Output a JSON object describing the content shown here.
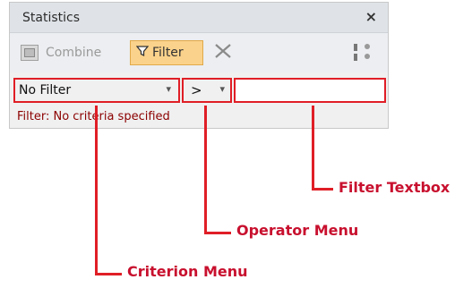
{
  "panel": {
    "title": "Statistics",
    "close_glyph": "×",
    "toolbar": {
      "combine_label": "Combine",
      "filter_label": "Filter",
      "filter_icon_glyph": "⏷",
      "clear_filter_glyph": "✕"
    },
    "filter_row": {
      "criterion_value": "No Filter",
      "operator_value": ">",
      "dropdown_arrow": "▾",
      "textbox_value": ""
    },
    "status_text": "Filter: No criteria specified"
  },
  "callouts": {
    "filter_textbox": "Filter Textbox",
    "operator_menu": "Operator Menu",
    "criterion_menu": "Criterion Menu"
  },
  "colors": {
    "highlight": "#e01e26",
    "callout_text": "#c8102e",
    "filter_button_bg": "#fbd28b"
  }
}
